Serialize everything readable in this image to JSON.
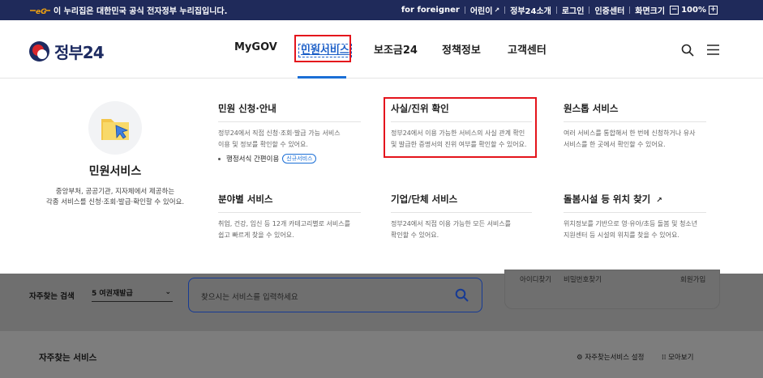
{
  "topbar": {
    "notice": "이 누리집은 대한민국 공식 전자정부 누리집입니다.",
    "links": [
      "for foreigner",
      "어린이",
      "정부24소개",
      "로그인",
      "인증센터",
      "화면크기"
    ],
    "zoom_minus": "−",
    "zoom_value": "100%",
    "zoom_plus": "+"
  },
  "header": {
    "logo_text": "정부24",
    "nav": [
      "MyGOV",
      "민원서비스",
      "보조금24",
      "정책정보",
      "고객센터"
    ]
  },
  "dropdown": {
    "intro_title": "민원서비스",
    "intro_desc_1": "중앙부처, 공공기관, 지자체에서 제공하는",
    "intro_desc_2": "각종 서비스를 신청·조회·발급·확인할 수 있어요.",
    "services": [
      {
        "title": "민원 신청·안내",
        "desc_1": "정부24에서 직접 신청·조회·발급 가능 서비스",
        "desc_2": "이용 및 정보를 확인할 수 있어요.",
        "sub": "행정서식 간편이용",
        "badge": "신규서비스"
      },
      {
        "title": "사실/진위 확인",
        "desc_1": "정부24에서 이용 가능한 서비스의 사실 관계 확인",
        "desc_2": "및 발급한 증명서의 진위 여부를 확인할 수 있어요."
      },
      {
        "title": "원스톱 서비스",
        "desc_1": "여러 서비스를 통합해서 한 번에 신청하거나 유사",
        "desc_2": "서비스를 한 곳에서 확인할 수 있어요."
      },
      {
        "title": "분야별 서비스",
        "desc_1": "취업, 건강, 임신 등 12개 카테고리별로 서비스를",
        "desc_2": "쉽고 빠르게 찾을 수 있어요."
      },
      {
        "title": "기업/단체 서비스",
        "desc_1": "정부24에서 직접 이용 가능한 모든 서비스를",
        "desc_2": "확인할 수 있어요."
      },
      {
        "title": "돌봄시설 등 위치 찾기",
        "desc_1": "위치정보를 기반으로 영·유아/초등 돌봄 및 청소년",
        "desc_2": "지원센터 등 시설의 위치를 찾을 수 있어요."
      }
    ]
  },
  "background": {
    "frequent_search_label": "자주찾는 검색",
    "frequent_search_value": "5 여권재발급",
    "search_placeholder": "찾으시는 서비스를 입력하세요",
    "card_links": [
      "아이디찾기",
      "비밀번호찾기",
      "회원가입"
    ],
    "frequent_services_title": "자주찾는 서비스",
    "settings_label": "자주찾는서비스 설정",
    "view_all_label": "모아보기"
  },
  "colors": {
    "topbar_bg": "#1f2a5a",
    "accent": "#1b6fd6",
    "highlight_box": "#e4141c"
  }
}
